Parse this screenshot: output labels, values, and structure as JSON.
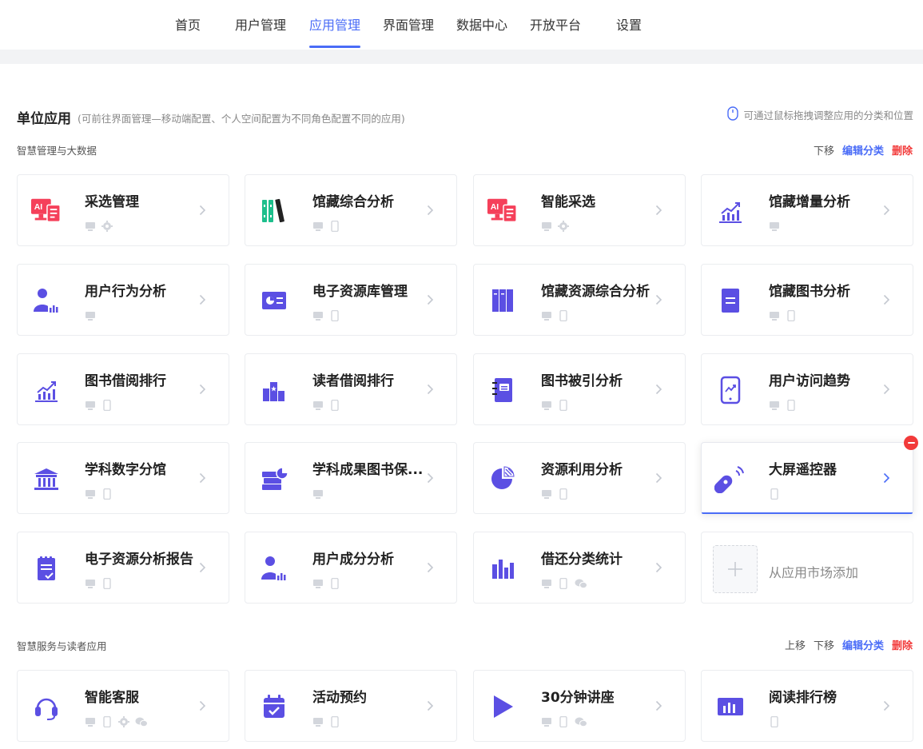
{
  "nav": {
    "items": [
      {
        "label": "首页",
        "active": false
      },
      {
        "label": "用户管理",
        "active": false
      },
      {
        "label": "应用管理",
        "active": true
      },
      {
        "label": "界面管理",
        "active": false
      },
      {
        "label": "数据中心",
        "active": false
      },
      {
        "label": "开放平台",
        "active": false
      },
      {
        "label": "设置",
        "active": false
      }
    ]
  },
  "page": {
    "title": "单位应用",
    "subtitle": "(可前往界面管理—移动端配置、个人空间配置为不同角色配置不同的应用)",
    "drag_hint": "可通过鼠标拖拽调整应用的分类和位置"
  },
  "sections": [
    {
      "title": "智慧管理与大数据",
      "actions": {
        "down": "下移",
        "edit": "编辑分类",
        "delete": "删除"
      },
      "apps": [
        {
          "name": "采选管理",
          "icon": "ai-screen-icon",
          "platforms": [
            "pc",
            "settings"
          ]
        },
        {
          "name": "馆藏综合分析",
          "icon": "books-icon",
          "platforms": [
            "pc",
            "mobile"
          ]
        },
        {
          "name": "智能采选",
          "icon": "ai-screen-icon",
          "platforms": [
            "pc",
            "settings"
          ]
        },
        {
          "name": "馆藏增量分析",
          "icon": "growth-chart-icon",
          "platforms": [
            "pc"
          ]
        },
        {
          "name": "用户行为分析",
          "icon": "user-chart-icon",
          "platforms": [
            "pc"
          ]
        },
        {
          "name": "电子资源库管理",
          "icon": "id-card-icon",
          "platforms": [
            "pc",
            "mobile"
          ]
        },
        {
          "name": "馆藏资源综合分析",
          "icon": "book-columns-icon",
          "platforms": [
            "pc",
            "mobile"
          ]
        },
        {
          "name": "馆藏图书分析",
          "icon": "document-icon",
          "platforms": [
            "pc",
            "mobile"
          ]
        },
        {
          "name": "图书借阅排行",
          "icon": "growth-chart-icon",
          "platforms": [
            "pc",
            "mobile"
          ]
        },
        {
          "name": "读者借阅排行",
          "icon": "podium-icon",
          "platforms": [
            "pc",
            "mobile"
          ]
        },
        {
          "name": "图书被引分析",
          "icon": "notebook-icon",
          "platforms": [
            "pc",
            "mobile"
          ]
        },
        {
          "name": "用户访问趋势",
          "icon": "phone-trend-icon",
          "platforms": [
            "pc",
            "mobile"
          ]
        },
        {
          "name": "学科数字分馆",
          "icon": "bank-icon",
          "platforms": [
            "pc",
            "mobile"
          ]
        },
        {
          "name": "学科成果图书保...",
          "icon": "book-stack-icon",
          "platforms": [
            "pc"
          ]
        },
        {
          "name": "资源利用分析",
          "icon": "pie-icon",
          "platforms": [
            "pc",
            "mobile"
          ]
        },
        {
          "name": "大屏遥控器",
          "icon": "remote-icon",
          "platforms": [
            "mobile"
          ],
          "selected": true
        },
        {
          "name": "电子资源分析报告",
          "icon": "report-icon",
          "platforms": [
            "pc",
            "mobile"
          ]
        },
        {
          "name": "用户成分分析",
          "icon": "user-chart-icon",
          "platforms": [
            "pc",
            "mobile"
          ]
        },
        {
          "name": "借还分类统计",
          "icon": "bar-chart-icon",
          "platforms": [
            "pc",
            "mobile",
            "wechat"
          ]
        }
      ],
      "add_label": "从应用市场添加"
    },
    {
      "title": "智慧服务与读者应用",
      "actions": {
        "up": "上移",
        "down": "下移",
        "edit": "编辑分类",
        "delete": "删除"
      },
      "apps": [
        {
          "name": "智能客服",
          "icon": "headset-icon",
          "platforms": [
            "pc",
            "mobile",
            "settings",
            "wechat"
          ]
        },
        {
          "name": "活动预约",
          "icon": "calendar-check-icon",
          "platforms": [
            "pc",
            "mobile"
          ]
        },
        {
          "name": "30分钟讲座",
          "icon": "play-icon",
          "platforms": [
            "pc",
            "mobile",
            "wechat"
          ]
        },
        {
          "name": "阅读排行榜",
          "icon": "ranking-board-icon",
          "platforms": [
            "mobile"
          ]
        }
      ]
    }
  ],
  "colors": {
    "accent": "#4a6cf7",
    "danger": "#f23a3a",
    "icon_purple": "#5b4fe3",
    "icon_red": "#f5405a",
    "icon_green": "#1dbf8c"
  }
}
